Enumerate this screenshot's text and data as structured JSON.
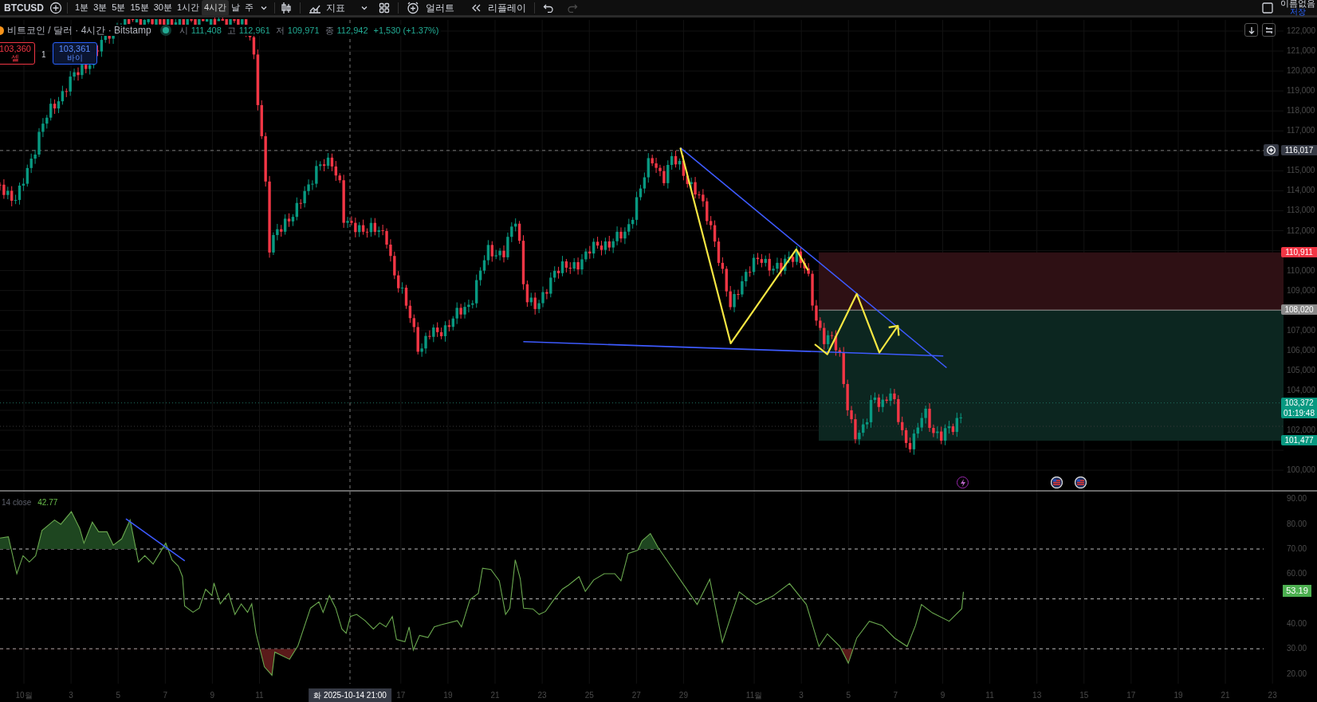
{
  "toolbar": {
    "symbol": "BTCUSD",
    "intervals": [
      {
        "label": "1분",
        "selected": false
      },
      {
        "label": "3분",
        "selected": false
      },
      {
        "label": "5분",
        "selected": false
      },
      {
        "label": "15분",
        "selected": false
      },
      {
        "label": "30분",
        "selected": false
      },
      {
        "label": "1시간",
        "selected": false
      },
      {
        "label": "4시간",
        "selected": true
      },
      {
        "label": "날",
        "selected": false
      },
      {
        "label": "주",
        "selected": false
      }
    ],
    "indicators_label": "지표",
    "alert_label": "얼러트",
    "replay_label": "리플레이",
    "undo": {
      "disabled": false
    },
    "redo": {
      "disabled": true
    },
    "layout_name": "이름없음",
    "save_label": "저장"
  },
  "legend": {
    "title": "비트코인 / 달러 · 4시간 · Bitstamp",
    "ohlc": [
      {
        "label": "시",
        "value": "111,408"
      },
      {
        "label": "고",
        "value": "112,961"
      },
      {
        "label": "저",
        "value": "109,971"
      },
      {
        "label": "종",
        "value": "112,942"
      }
    ],
    "change": "+1,530 (+1.37%)"
  },
  "trade": {
    "sell_price": "103,360",
    "sell_label": "셀",
    "quantity": "1",
    "buy_price": "103,361",
    "buy_label": "바이"
  },
  "price_axis": {
    "ticks": [
      "122,000",
      "121,000",
      "120,000",
      "119,000",
      "118,000",
      "117,000",
      "115,000",
      "114,000",
      "113,000",
      "112,000",
      "110,000",
      "109,000",
      "107,000",
      "106,000",
      "105,000",
      "104,000",
      "102,000",
      "100,000"
    ]
  },
  "price_labels": [
    {
      "kind": "crosshair",
      "text": "116,017"
    },
    {
      "kind": "stop",
      "text": "110,911"
    },
    {
      "kind": "entry",
      "text": "108,020"
    },
    {
      "kind": "last",
      "text": "103,372",
      "sub": "01:19:48"
    },
    {
      "kind": "target",
      "text": "101,477"
    }
  ],
  "rsi": {
    "legend": "14 close",
    "value": "42.77",
    "ticks": [
      "90.00",
      "80.00",
      "70.00",
      "60.00",
      "40.00",
      "30.00",
      "20.00"
    ],
    "last": "53.19"
  },
  "time_axis": {
    "ticks": [
      "10월",
      "3",
      "5",
      "7",
      "9",
      "11",
      "17",
      "19",
      "21",
      "23",
      "25",
      "27",
      "29",
      "11월",
      "3",
      "5",
      "7",
      "9",
      "11",
      "13",
      "15",
      "17",
      "19",
      "21",
      "23"
    ],
    "crosshair_label": "화 2025-10-14  21:00"
  }
}
